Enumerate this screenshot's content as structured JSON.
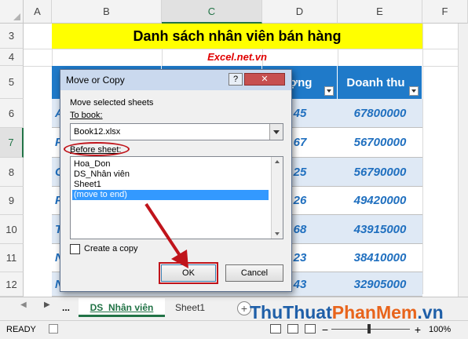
{
  "columns": [
    "A",
    "B",
    "C",
    "D",
    "E",
    "F"
  ],
  "selected_column": "C",
  "rows": [
    "3",
    "4",
    "5",
    "6",
    "7",
    "8",
    "9",
    "10",
    "11",
    "12"
  ],
  "selected_row": "7",
  "sheet": {
    "title": "Danh sách nhân viên bán hàng",
    "subtitle": "Excel.net.vn",
    "visible_header_c": "ượng",
    "header_e": "Doanh thu",
    "col_d_values": [
      "45",
      "67",
      "25",
      "26",
      "68",
      "23",
      "43"
    ],
    "col_e_values": [
      "67800000",
      "56700000",
      "56790000",
      "49420000",
      "43915000",
      "38410000",
      "32905000"
    ],
    "col_b_letters": [
      "A",
      "P",
      "G",
      "P",
      "T",
      "N",
      "N"
    ],
    "accent_color": "#1f7ac9",
    "title_band_color": "#ffff00"
  },
  "tabs": {
    "ellipsis": "...",
    "active": "DS_Nhân viên",
    "other": "Sheet1",
    "add": "+"
  },
  "status": {
    "mode": "READY",
    "zoom": "100%",
    "minus": "−",
    "plus": "+"
  },
  "watermark": {
    "part1": "ThuThuat",
    "part2": "PhanMem",
    "part3": ".vn"
  },
  "dialog": {
    "title": "Move or Copy",
    "help": "?",
    "close": "✕",
    "label_move": "Move selected sheets",
    "label_to_book": "To book:",
    "book_value": "Book12.xlsx",
    "label_before": "Before sheet:",
    "sheets": [
      "Hoa_Don",
      "DS_Nhân viên",
      "Sheet1",
      "(move to end)"
    ],
    "selected_sheet_index": 3,
    "create_copy": "Create a copy",
    "create_copy_checked": false,
    "ok": "OK",
    "cancel": "Cancel"
  }
}
